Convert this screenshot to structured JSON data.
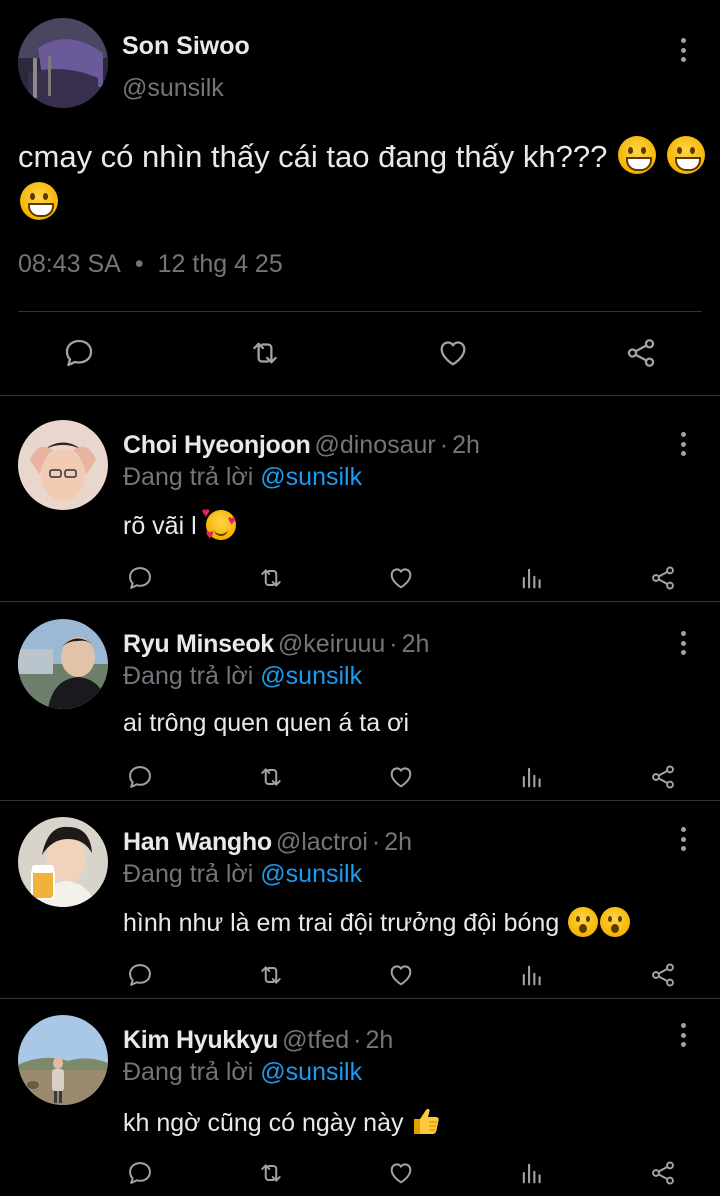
{
  "main_tweet": {
    "author_name": "Son Siwoo",
    "author_handle": "@sunsilk",
    "text": "cmay có nhìn thấy cái tao đang thấy kh???",
    "time": "08:43 SA",
    "separator": "•",
    "date": "12 thg 4 25",
    "icons": [
      "reply-icon",
      "retweet-icon",
      "like-icon",
      "share-icon"
    ]
  },
  "replies": [
    {
      "name": "Choi Hyeonjoon",
      "handle": "@dinosaur",
      "sep": "·",
      "time": "2h",
      "replying_prefix": "Đang trả lời",
      "replying_to": "@sunsilk",
      "text": "rõ vãi l",
      "emoji": "smiling-face-with-hearts"
    },
    {
      "name": "Ryu Minseok",
      "handle": "@keiruuu",
      "sep": "·",
      "time": "2h",
      "replying_prefix": "Đang trả lời",
      "replying_to": "@sunsilk",
      "text": "ai trông quen quen á ta ơi",
      "emoji": ""
    },
    {
      "name": "Han Wangho",
      "handle": "@lactroi",
      "sep": "·",
      "time": "2h",
      "replying_prefix": "Đang trả lời",
      "replying_to": "@sunsilk",
      "text": "hình như là em trai đội trưởng đội bóng",
      "emoji": "face-with-open-mouth x2"
    },
    {
      "name": "Kim Hyukkyu",
      "handle": "@tfed",
      "sep": "·",
      "time": "2h",
      "replying_prefix": "Đang trả lời",
      "replying_to": "@sunsilk",
      "text": "kh ngờ cũng có ngày này",
      "emoji": "thumbs-up"
    }
  ],
  "reply_icons": [
    "reply-icon",
    "retweet-icon",
    "like-icon",
    "views-icon",
    "share-icon"
  ],
  "colors": {
    "background": "#000000",
    "text_primary": "#e7e9ea",
    "text_secondary": "#71767b",
    "accent": "#1d9bf0",
    "divider": "#2f3336"
  }
}
